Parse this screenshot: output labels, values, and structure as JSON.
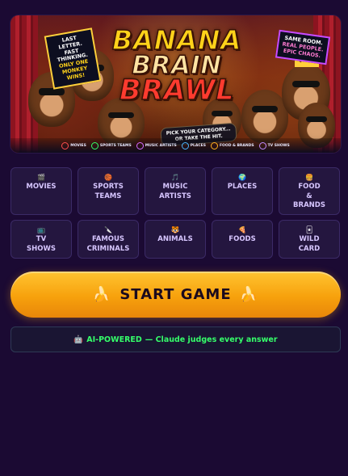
{
  "banner": {
    "title_lines": [
      "BANANA",
      "BRAIN",
      "BRAWL"
    ],
    "left_sign": [
      "LAST LETTER.",
      "FAST THINKING.",
      "ONLY ONE",
      "MONKEY WINS!"
    ],
    "right_sign": [
      "SAME ROOM.",
      "REAL PEOPLE.",
      "EPIC CHAOS."
    ],
    "bubble": [
      "PICK YOUR CATEGORY...",
      "OR TAKE THE HIT."
    ],
    "strip": [
      {
        "label": "MOVIES",
        "icon": "film-icon",
        "color": "#ff4d4d"
      },
      {
        "label": "SPORTS TEAMS",
        "icon": "ball-icon",
        "color": "#35ff6a"
      },
      {
        "label": "MUSIC ARTISTS",
        "icon": "music-icon",
        "color": "#d46bff"
      },
      {
        "label": "PLACES",
        "icon": "globe-icon",
        "color": "#4db5ff"
      },
      {
        "label": "FOOD & BRANDS",
        "icon": "food-icon",
        "color": "#ffb020"
      },
      {
        "label": "TV SHOWS",
        "icon": "tv-icon",
        "color": "#c08bff"
      }
    ]
  },
  "categories": [
    {
      "label": "MOVIES",
      "icon": "🎬"
    },
    {
      "label": "SPORTS\nTEAMS",
      "icon": "🏀"
    },
    {
      "label": "MUSIC\nARTISTS",
      "icon": "🎵"
    },
    {
      "label": "PLACES",
      "icon": "🌍"
    },
    {
      "label": "FOOD\n&\nBRANDS",
      "icon": "🍔"
    },
    {
      "label": "TV\nSHOWS",
      "icon": "📺"
    },
    {
      "label": "FAMOUS\nCRIMINALS",
      "icon": "🔪"
    },
    {
      "label": "ANIMALS",
      "icon": "🐯"
    },
    {
      "label": "FOODS",
      "icon": "🍕"
    },
    {
      "label": "WILD\nCARD",
      "icon": "🃏"
    }
  ],
  "start_button": {
    "label": "START GAME",
    "icon": "🍌"
  },
  "ai_bar": {
    "icon": "🤖",
    "highlight": "AI-POWERED",
    "rest": "— Claude judges every answer"
  },
  "colors": {
    "background": "#1b0a33",
    "accent": "#ffc431",
    "ai_green": "#35ff6a",
    "card_bg": "#24163f"
  }
}
